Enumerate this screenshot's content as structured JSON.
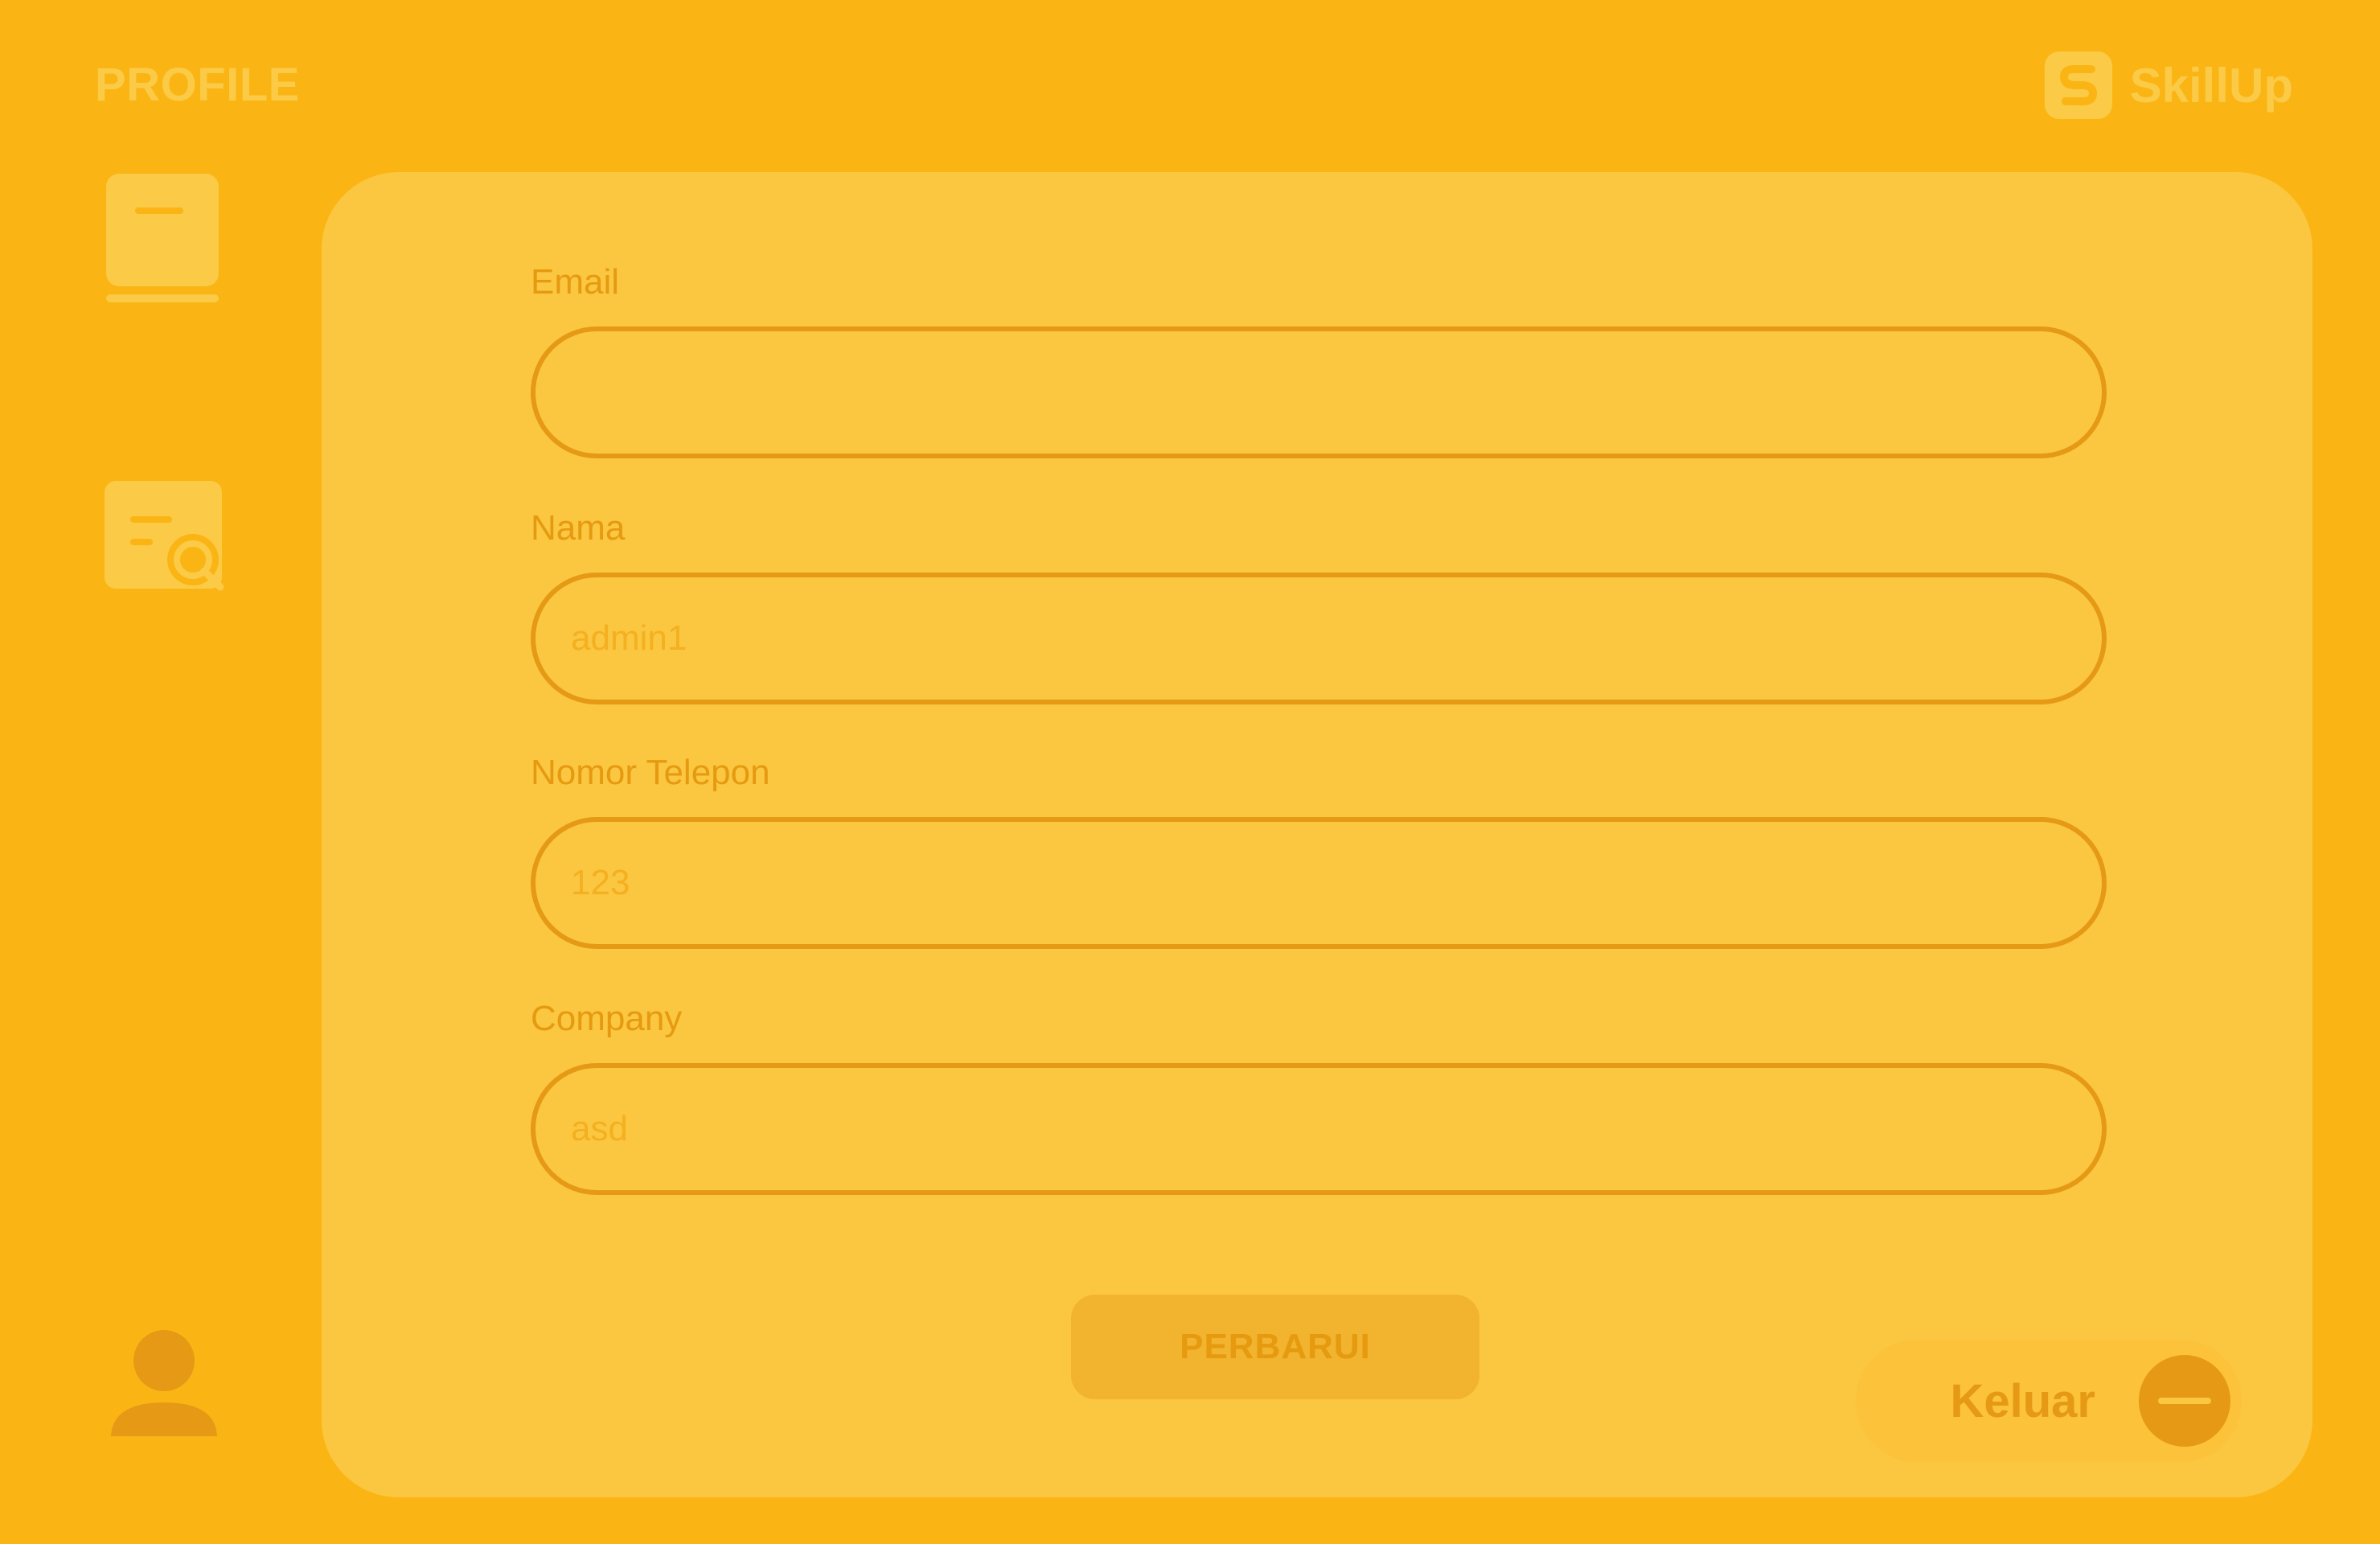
{
  "header": {
    "title": "PROFILE",
    "brand_name": "SkillUp",
    "brand_logo_icon": "skillup-logo-icon"
  },
  "sidebar": {
    "items": [
      {
        "icon": "book-icon"
      },
      {
        "icon": "search-document-icon"
      },
      {
        "icon": "user-icon"
      }
    ]
  },
  "form": {
    "email": {
      "label": "Email",
      "value": "",
      "placeholder": ""
    },
    "nama": {
      "label": "Nama",
      "value": "admin1",
      "placeholder": ""
    },
    "telepon": {
      "label": "Nomor Telepon",
      "value": "123",
      "placeholder": ""
    },
    "company": {
      "label": "Company",
      "value": "asd",
      "placeholder": ""
    },
    "update_label": "PERBARUI"
  },
  "logout": {
    "label": "Keluar",
    "icon": "minus-circle-icon"
  },
  "colors": {
    "background": "#fab514",
    "card": "#fbc640",
    "accent": "#e59915",
    "muted": "#fbca46"
  }
}
